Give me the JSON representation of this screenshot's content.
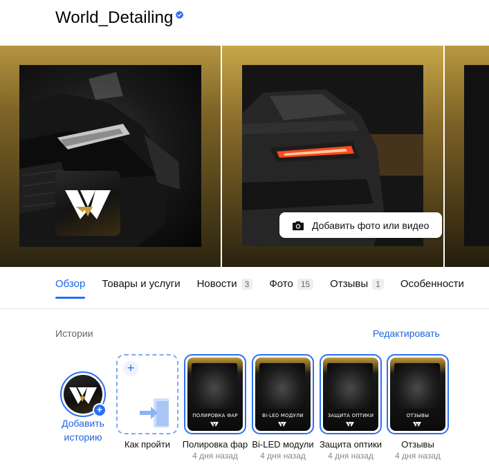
{
  "header": {
    "title": "World_Detailing",
    "verified_icon": "verified-badge-icon",
    "accent_color": "#2a6ff3"
  },
  "gallery": {
    "add_media_label": "Добавить фото или видео",
    "add_media_icon": "camera-icon"
  },
  "tabs": [
    {
      "label": "Обзор",
      "count": null,
      "active": true
    },
    {
      "label": "Товары и услуги",
      "count": null,
      "active": false
    },
    {
      "label": "Новости",
      "count": "3",
      "active": false
    },
    {
      "label": "Фото",
      "count": "15",
      "active": false
    },
    {
      "label": "Отзывы",
      "count": "1",
      "active": false
    },
    {
      "label": "Особенности",
      "count": null,
      "active": false
    }
  ],
  "stories": {
    "section_label": "Истории",
    "edit_label": "Редактировать",
    "add_story_label": "Добавить историю",
    "how_to_get_label": "Как пройти",
    "items": [
      {
        "caption": "ПОЛИРОВКА ФАР",
        "title": "Полировка фар",
        "date": "4 дня назад"
      },
      {
        "caption": "BI-LED МОДУЛИ",
        "title": "Bi-LED модули",
        "date": "4 дня назад"
      },
      {
        "caption": "ЗАЩИТА ОПТИКИ",
        "title": "Защита оптики",
        "date": "4 дня назад"
      },
      {
        "caption": "ОТЗЫВЫ",
        "title": "Отзывы",
        "date": "4 дня назад"
      }
    ]
  }
}
